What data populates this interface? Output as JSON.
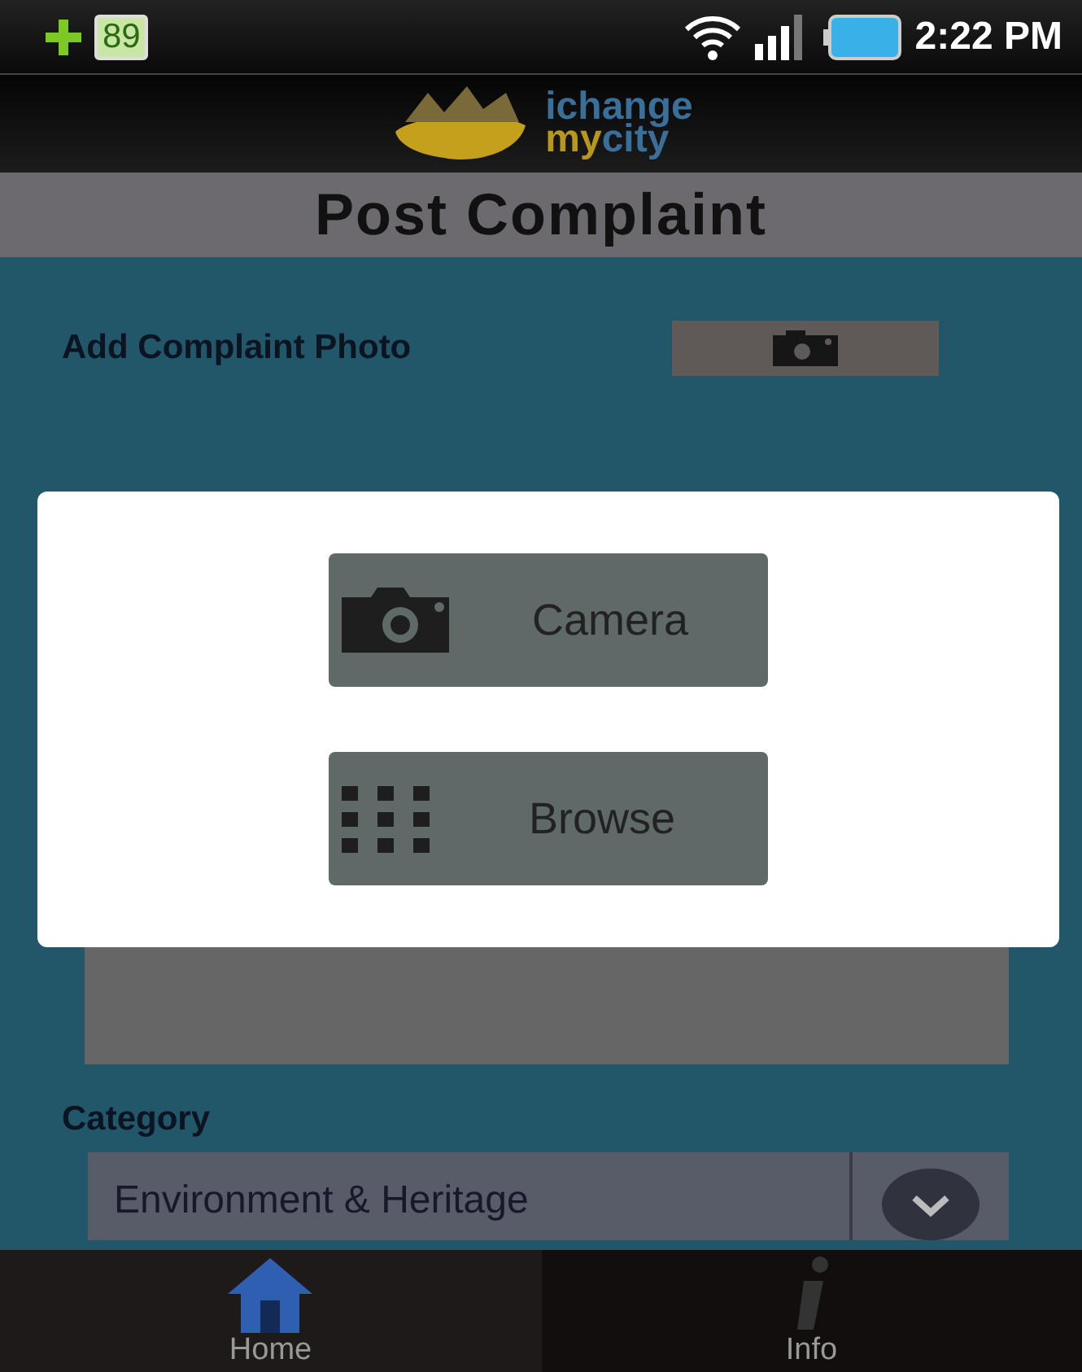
{
  "status_bar": {
    "battery": "89",
    "time": "2:22 PM"
  },
  "logo": {
    "line1": "ichange",
    "line2_a": "my",
    "line2_b": "city"
  },
  "title": "Post Complaint",
  "form": {
    "photo_label": "Add Complaint Photo",
    "category_label": "Category",
    "category_value": "Environment & Heritage"
  },
  "dialog": {
    "options": [
      {
        "kind": "camera",
        "label": "Camera"
      },
      {
        "kind": "browse",
        "label": "Browse"
      }
    ]
  },
  "nav": [
    {
      "kind": "home",
      "label": "Home",
      "selected": true
    },
    {
      "kind": "info",
      "label": "Info",
      "selected": false
    }
  ]
}
